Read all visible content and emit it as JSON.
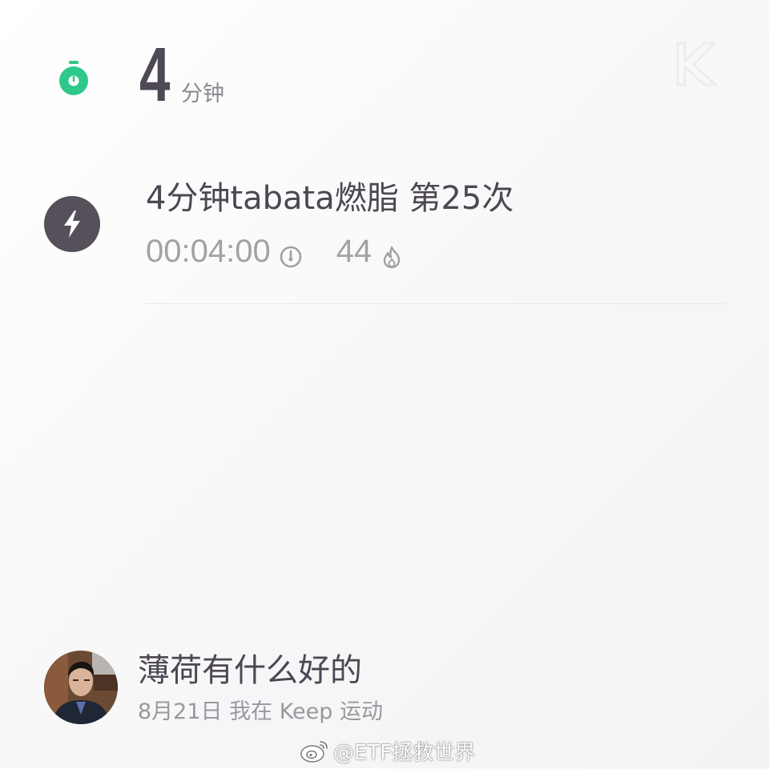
{
  "summary": {
    "duration_value": "4",
    "duration_unit": "分钟",
    "timer_icon": "stopwatch-icon",
    "brand_icon": "keep-logo-icon",
    "accent_color": "#2ec98a"
  },
  "workout": {
    "icon": "lightning-bolt-icon",
    "title": "4分钟tabata燃脂 第25次",
    "time": "00:04:00",
    "time_icon": "clock-icon",
    "calories": "44",
    "calories_icon": "flame-icon"
  },
  "footer": {
    "user_name": "薄荷有什么好的",
    "activity_meta": "8月21日 我在 Keep 运动",
    "avatar_icon": "avatar-photo"
  },
  "watermark": {
    "text": "@ETF拯救世界",
    "icon": "weibo-icon"
  }
}
